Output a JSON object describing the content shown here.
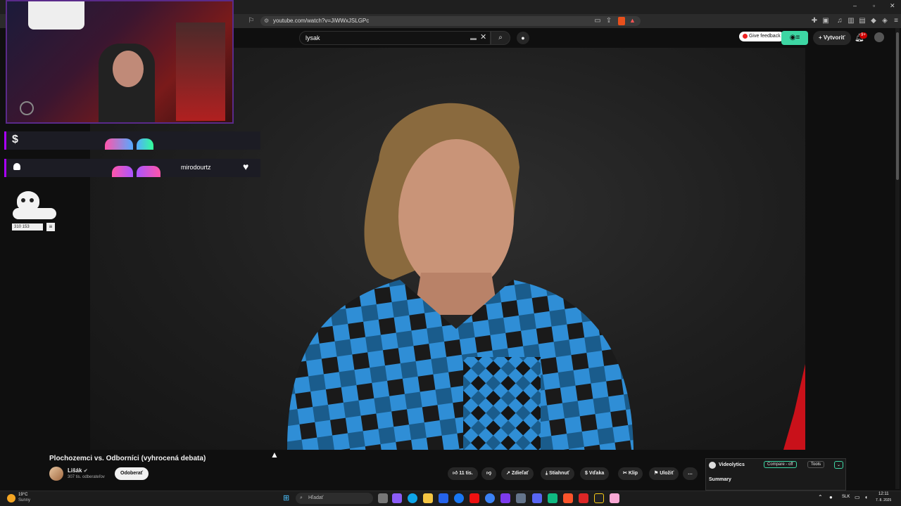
{
  "browser": {
    "url": "youtube.com/watch?v=JiWWxJSLGPc",
    "window_controls": [
      "–",
      "▫",
      "✕"
    ]
  },
  "youtube": {
    "search_value": "lysak",
    "give_feedback": "Give feedback",
    "create_label": "Vytvoriť",
    "notif_count": "9+"
  },
  "overlay": {
    "dollar": "$",
    "username": "mirodourtz",
    "counter": "310 153"
  },
  "video": {
    "title": "Plochozemci vs. Odborníci (vyhrocená debata)",
    "channel": "Lišák",
    "subscribers": "307 tis. odberateľov",
    "subscribe_label": "Odoberať",
    "likes": "11 tis.",
    "share": "Zdieľať",
    "download": "Stiahnuť",
    "thanks": "Vďaka",
    "clip": "Klip",
    "save": "Uložiť",
    "more": "…"
  },
  "videolytics": {
    "name": "Videolytics",
    "compare": "Compare - off",
    "tools": "Tools",
    "summary": "Summary"
  },
  "taskbar": {
    "weather_temp": "19°C",
    "weather_desc": "Sunny",
    "search_placeholder": "Hľadať",
    "lang": "SLK",
    "time": "12:11",
    "date": "7. 8. 2025"
  },
  "colors": {
    "shirt_blue": "#2f8ed6",
    "accent_green": "#3dd6a3",
    "notif_red": "#cc0000"
  }
}
